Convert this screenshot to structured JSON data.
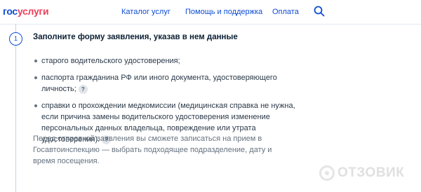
{
  "header": {
    "logo_part1": "гос",
    "logo_part2": "услуги",
    "nav": [
      {
        "label": "Каталог услуг"
      },
      {
        "label": "Помощь и поддержка"
      },
      {
        "label": "Оплата"
      }
    ],
    "search_icon": "search-icon"
  },
  "step": {
    "number": "1",
    "title": "Заполните форму заявления, указав в нем данные"
  },
  "list": [
    {
      "text": "старого водительского удостоверения;",
      "help": false
    },
    {
      "text": "паспорта гражданина РФ или иного документа, удостоверяющего личность;",
      "help": true
    },
    {
      "text": "справки о прохождении медкомиссии (медицинская справка не нужна, если причина замены водительского удостоверения изменение персональных данных владельца, повреждение или утрата удостоверения).",
      "help": true
    }
  ],
  "help_glyph": "?",
  "paragraph": "Перед отправкой заявления вы сможете записаться на прием в Госавтоинспекцию — выбрать подходящее подразделение, дату и время посещения.",
  "watermark": {
    "text": "ОТЗОВИК"
  },
  "colors": {
    "brand_blue": "#0d4cd3",
    "brand_red": "#ee3f58",
    "text_dark": "#0b1f33",
    "text_muted": "#66727f"
  }
}
